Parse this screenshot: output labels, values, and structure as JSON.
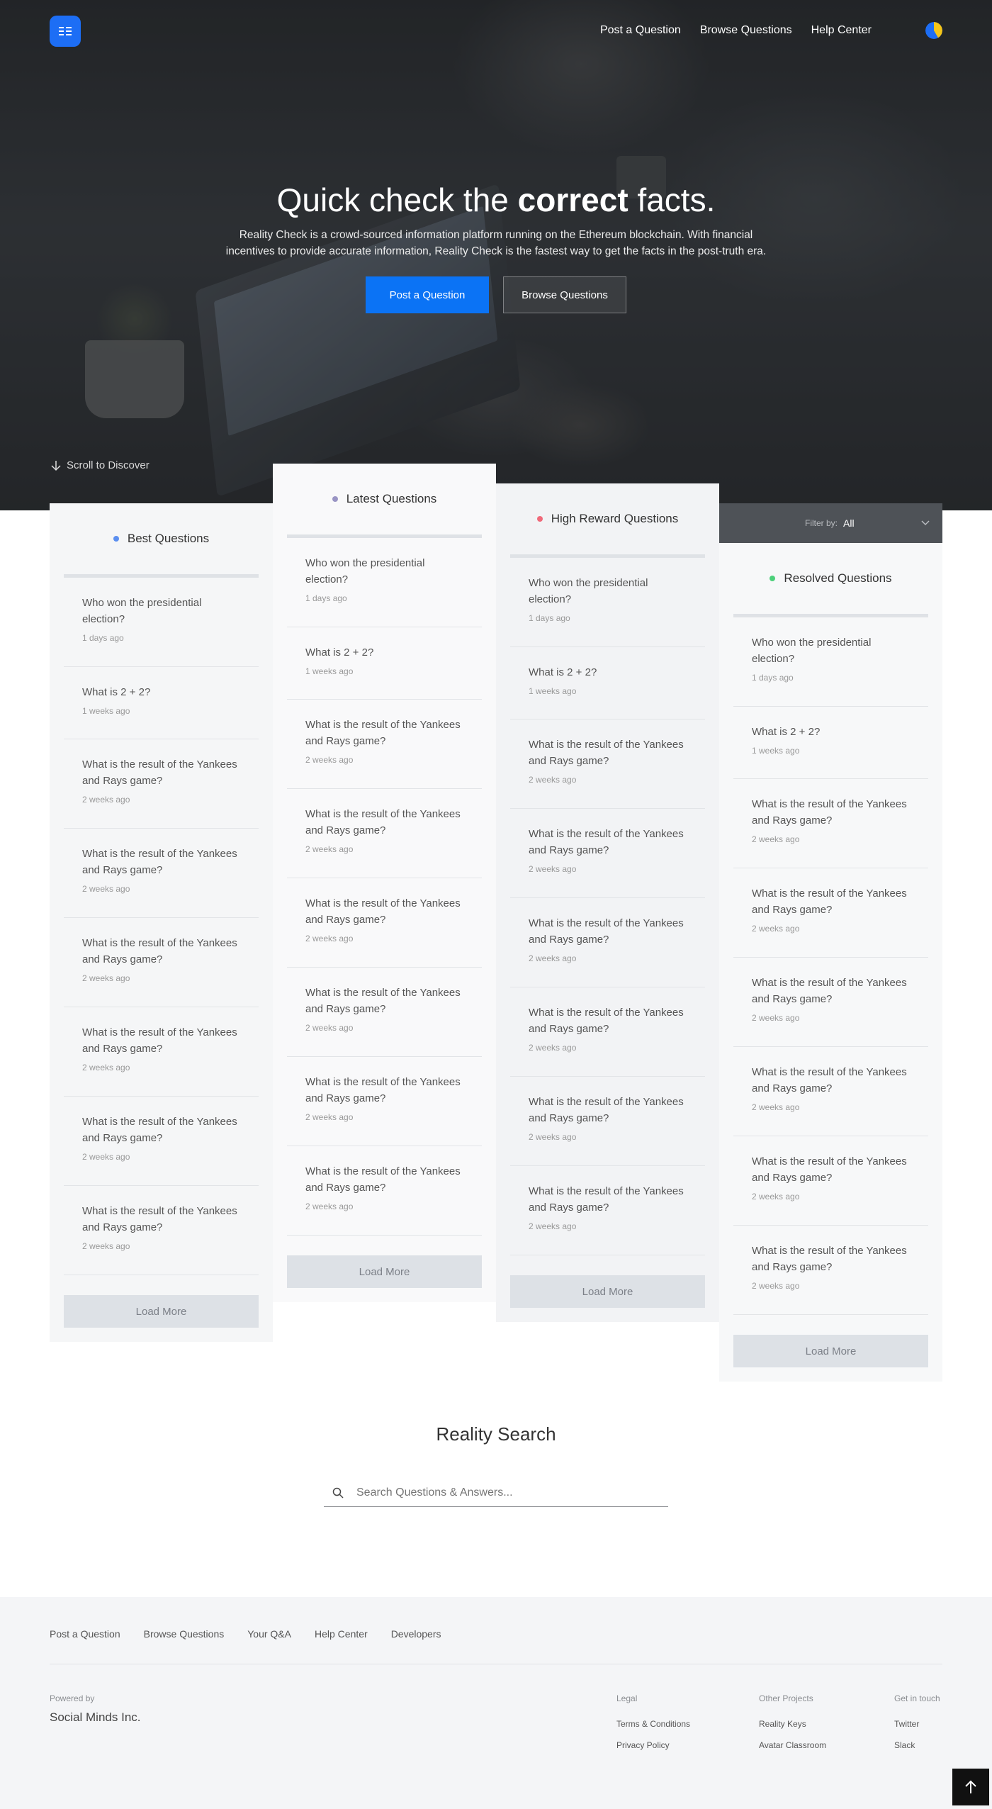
{
  "nav": {
    "items": [
      "Post a Question",
      "Browse Questions",
      "Help Center"
    ]
  },
  "hero": {
    "title_prefix": "Quick check the ",
    "title_bold": "correct",
    "title_suffix": " facts.",
    "description": "Reality Check is a crowd-sourced information platform running on the Ethereum blockchain. With financial incentives to provide accurate information, Reality Check is the fastest way to get the facts in the post-truth era.",
    "primary_button": "Post a Question",
    "secondary_button": "Browse Questions",
    "scroll_hint": "Scroll to Discover"
  },
  "columns": [
    {
      "title": "Best Questions",
      "dot_color": "#5b8ff0",
      "load_more": "Load More",
      "questions": [
        {
          "text": "Who won the presidential election?",
          "date": "1 days ago"
        },
        {
          "text": "What is 2 + 2?",
          "date": "1 weeks ago"
        },
        {
          "text": "What is the result of the Yankees and Rays game?",
          "date": "2 weeks ago"
        },
        {
          "text": "What is the result of the Yankees and Rays game?",
          "date": "2 weeks ago"
        },
        {
          "text": "What is the result of the Yankees and Rays game?",
          "date": "2 weeks ago"
        },
        {
          "text": "What is the result of the Yankees and Rays game?",
          "date": "2 weeks ago"
        },
        {
          "text": "What is the result of the Yankees and Rays game?",
          "date": "2 weeks ago"
        },
        {
          "text": "What is the result of the Yankees and Rays game?",
          "date": "2 weeks ago"
        }
      ]
    },
    {
      "title": "Latest Questions",
      "dot_color": "#9a95c4",
      "load_more": "Load More",
      "questions": [
        {
          "text": "Who won the presidential election?",
          "date": "1 days ago"
        },
        {
          "text": "What is 2 + 2?",
          "date": "1 weeks ago"
        },
        {
          "text": "What is the result of the Yankees and Rays game?",
          "date": "2 weeks ago"
        },
        {
          "text": "What is the result of the Yankees and Rays game?",
          "date": "2 weeks ago"
        },
        {
          "text": "What is the result of the Yankees and Rays game?",
          "date": "2 weeks ago"
        },
        {
          "text": "What is the result of the Yankees and Rays game?",
          "date": "2 weeks ago"
        },
        {
          "text": "What is the result of the Yankees and Rays game?",
          "date": "2 weeks ago"
        },
        {
          "text": "What is the result of the Yankees and Rays game?",
          "date": "2 weeks ago"
        }
      ]
    },
    {
      "title": "High Reward Questions",
      "dot_color": "#f06a7a",
      "load_more": "Load More",
      "questions": [
        {
          "text": "Who won the presidential election?",
          "date": "1 days ago"
        },
        {
          "text": "What is 2 + 2?",
          "date": "1 weeks ago"
        },
        {
          "text": "What is the result of the Yankees and Rays game?",
          "date": "2 weeks ago"
        },
        {
          "text": "What is the result of the Yankees and Rays game?",
          "date": "2 weeks ago"
        },
        {
          "text": "What is the result of the Yankees and Rays game?",
          "date": "2 weeks ago"
        },
        {
          "text": "What is the result of the Yankees and Rays game?",
          "date": "2 weeks ago"
        },
        {
          "text": "What is the result of the Yankees and Rays game?",
          "date": "2 weeks ago"
        },
        {
          "text": "What is the result of the Yankees and Rays game?",
          "date": "2 weeks ago"
        }
      ]
    },
    {
      "title": "Resolved Questions",
      "dot_color": "#4cd07a",
      "load_more": "Load More",
      "filter_label": "Filter by:",
      "filter_value": "All",
      "questions": [
        {
          "text": "Who won the presidential election?",
          "date": "1 days ago"
        },
        {
          "text": "What is 2 + 2?",
          "date": "1 weeks ago"
        },
        {
          "text": "What is the result of the Yankees and Rays game?",
          "date": "2 weeks ago"
        },
        {
          "text": "What is the result of the Yankees and Rays game?",
          "date": "2 weeks ago"
        },
        {
          "text": "What is the result of the Yankees and Rays game?",
          "date": "2 weeks ago"
        },
        {
          "text": "What is the result of the Yankees and Rays game?",
          "date": "2 weeks ago"
        },
        {
          "text": "What is the result of the Yankees and Rays game?",
          "date": "2 weeks ago"
        },
        {
          "text": "What is the result of the Yankees and Rays game?",
          "date": "2 weeks ago"
        }
      ]
    }
  ],
  "search": {
    "title": "Reality Search",
    "placeholder": "Search Questions & Answers..."
  },
  "footer": {
    "links": [
      "Post a Question",
      "Browse Questions",
      "Your Q&A",
      "Help Center",
      "Developers"
    ],
    "powered_by": "Powered by",
    "company": "Social Minds Inc.",
    "legal": {
      "heading": "Legal",
      "items": [
        "Terms & Conditions",
        "Privacy Policy"
      ]
    },
    "projects": {
      "heading": "Other Projects",
      "items": [
        "Reality Keys",
        "Avatar Classroom"
      ]
    },
    "contact": {
      "heading": "Get in touch",
      "items": [
        "Twitter",
        "Slack"
      ]
    }
  },
  "colors": {
    "accent": "#0b73f5",
    "dark": "#111111"
  },
  "icons": {
    "logo": "menu-grid-icon",
    "avatar": "pie-avatar-icon",
    "scroll": "arrow-down-icon",
    "search": "search-icon",
    "filter": "chevron-down-icon",
    "to_top": "arrow-up-icon"
  }
}
